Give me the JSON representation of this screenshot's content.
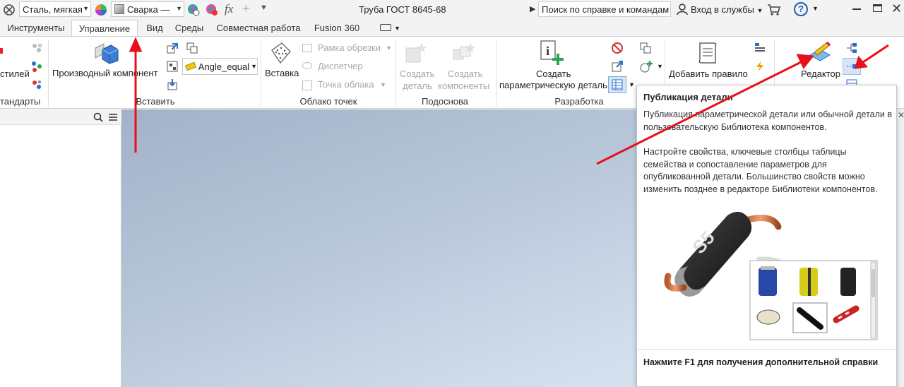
{
  "titlebar": {
    "material": "Сталь, мягкая",
    "appearance": "Сварка —",
    "title": "Труба ГОСТ 8645-68",
    "search": "Поиск по справке и командам",
    "signin": "Вход в службы",
    "fx": "fx",
    "help": "?"
  },
  "tabs": [
    "Инструменты",
    "Управление",
    "Вид",
    "Среды",
    "Совместная работа",
    "Fusion 360"
  ],
  "ribbon": {
    "styles_label": "стилей",
    "standards_title": "тандарты",
    "derived_label": "Производный компонент",
    "angle_label": "Angle_equal",
    "insert_title": "Вставить",
    "insert_label": "Вставка",
    "crop_frame": "Рамка обрезки",
    "manager": "Диспетчер",
    "cloud_point": "Точка облака",
    "pointcloud_title": "Облако точек",
    "create_part_1": "Создать",
    "create_part_2": "деталь",
    "create_comp_1": "Создать",
    "create_comp_2": "компоненты",
    "layout_title": "Подоснова",
    "param_1": "Создать",
    "param_2": "параметрическую деталь",
    "dev_title": "Разработка",
    "add_rule": "Добавить правило",
    "editor": "Редактор"
  },
  "tooltip": {
    "title": "Публикация детали",
    "p1": "Публикация параметрической детали или обычной детали в пользовательскую Библиотека компонентов.",
    "p2": "Настройте свойства, ключевые столбцы таблицы семейства и сопоставление параметров для опубликованной детали. Большинство свойств можно изменить позднее в редакторе Библиотеки компонентов.",
    "footer": "Нажмите F1 для получения дополнительной справки",
    "diode_text": "S5"
  },
  "colors": {
    "annotation": "#e8101a",
    "accent": "#1a73c7"
  }
}
